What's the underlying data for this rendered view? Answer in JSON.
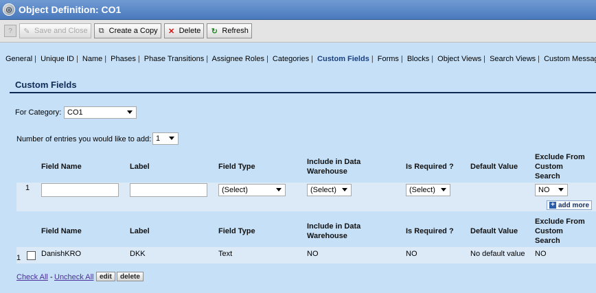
{
  "window": {
    "title": "Object Definition: CO1"
  },
  "toolbar": {
    "save_close": "Save and Close",
    "create_copy": "Create a Copy",
    "delete": "Delete",
    "refresh": "Refresh"
  },
  "tabs": [
    {
      "label": "General"
    },
    {
      "label": "Unique ID"
    },
    {
      "label": "Name"
    },
    {
      "label": "Phases"
    },
    {
      "label": "Phase Transitions"
    },
    {
      "label": "Assignee Roles"
    },
    {
      "label": "Categories"
    },
    {
      "label": "Custom Fields"
    },
    {
      "label": "Forms"
    },
    {
      "label": "Blocks"
    },
    {
      "label": "Object Views"
    },
    {
      "label": "Search Views"
    },
    {
      "label": "Custom Messages"
    }
  ],
  "panel": {
    "title": "Custom Fields",
    "category_label": "For Category:",
    "category_value": "CO1",
    "entries_label": "Number of entries you would like to add:",
    "entries_value": "1"
  },
  "columns": {
    "field_name": "Field Name",
    "label": "Label",
    "field_type": "Field Type",
    "include_line1": "Include in Data",
    "include_line2": "Warehouse",
    "is_required": "Is Required ?",
    "default_value": "Default Value",
    "exclude_line1": "Exclude From",
    "exclude_line2": "Custom",
    "exclude_line3": "Search"
  },
  "new_row": {
    "index": "1",
    "field_type": "(Select)",
    "include": "(Select)",
    "is_required": "(Select)",
    "exclude": "NO",
    "add_more": "add more"
  },
  "existing_rows": [
    {
      "index": "1",
      "field_name": "DanishKRO",
      "label": "DKK",
      "field_type": "Text",
      "include": "NO",
      "is_required": "NO",
      "default_value": "No default value",
      "exclude": "NO"
    }
  ],
  "footer": {
    "check_all": "Check All",
    "dash": "-",
    "uncheck_all": "Uncheck All",
    "edit": "edit",
    "delete": "delete"
  }
}
